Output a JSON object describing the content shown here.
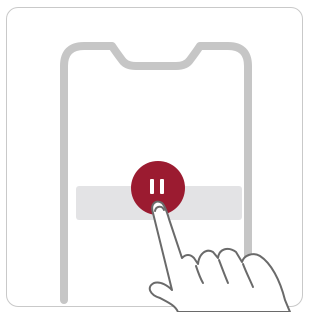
{
  "illustration": {
    "phone_outline_color": "#c6c6c6",
    "bar_color": "#e3e3e5",
    "button_color": "#9b1b30",
    "pause_icon_color": "#ffffff",
    "hand_stroke_color": "#6a6a6a",
    "icons": [
      "phone-frame-icon",
      "pause-icon",
      "tap-hand-icon"
    ]
  }
}
